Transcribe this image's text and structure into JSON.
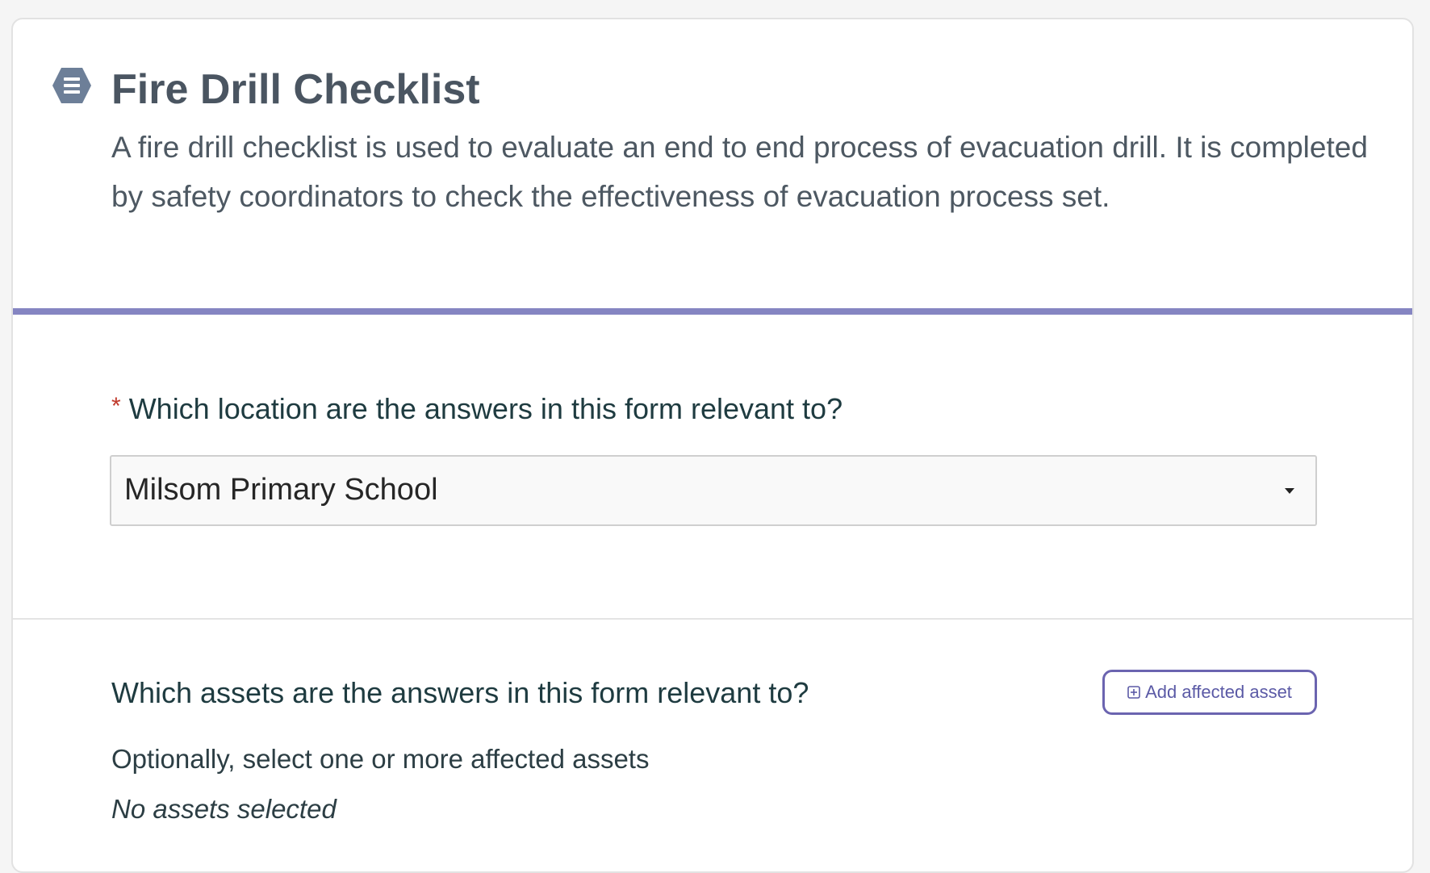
{
  "theme": {
    "accent": "#8585c2",
    "icon_color": "#6d7f98",
    "button_color": "#6b64b0"
  },
  "form": {
    "icon": "form-list-icon",
    "title": "Fire Drill Checklist",
    "description": "A fire drill checklist is used to evaluate an end to end process of evacuation drill. It is completed by safety coordinators to check the effectiveness of evacuation process set."
  },
  "location": {
    "required_mark": "*",
    "question": "Which location are the answers in this form relevant to?",
    "selected_value": "Milsom Primary School",
    "dropdown_icon": "caret-down-icon"
  },
  "assets": {
    "question": "Which assets are the answers in this form relevant to?",
    "add_button_icon": "plus-square-icon",
    "add_button_label": "Add affected asset",
    "help_text": "Optionally, select one or more affected assets",
    "empty_text": "No assets selected"
  }
}
